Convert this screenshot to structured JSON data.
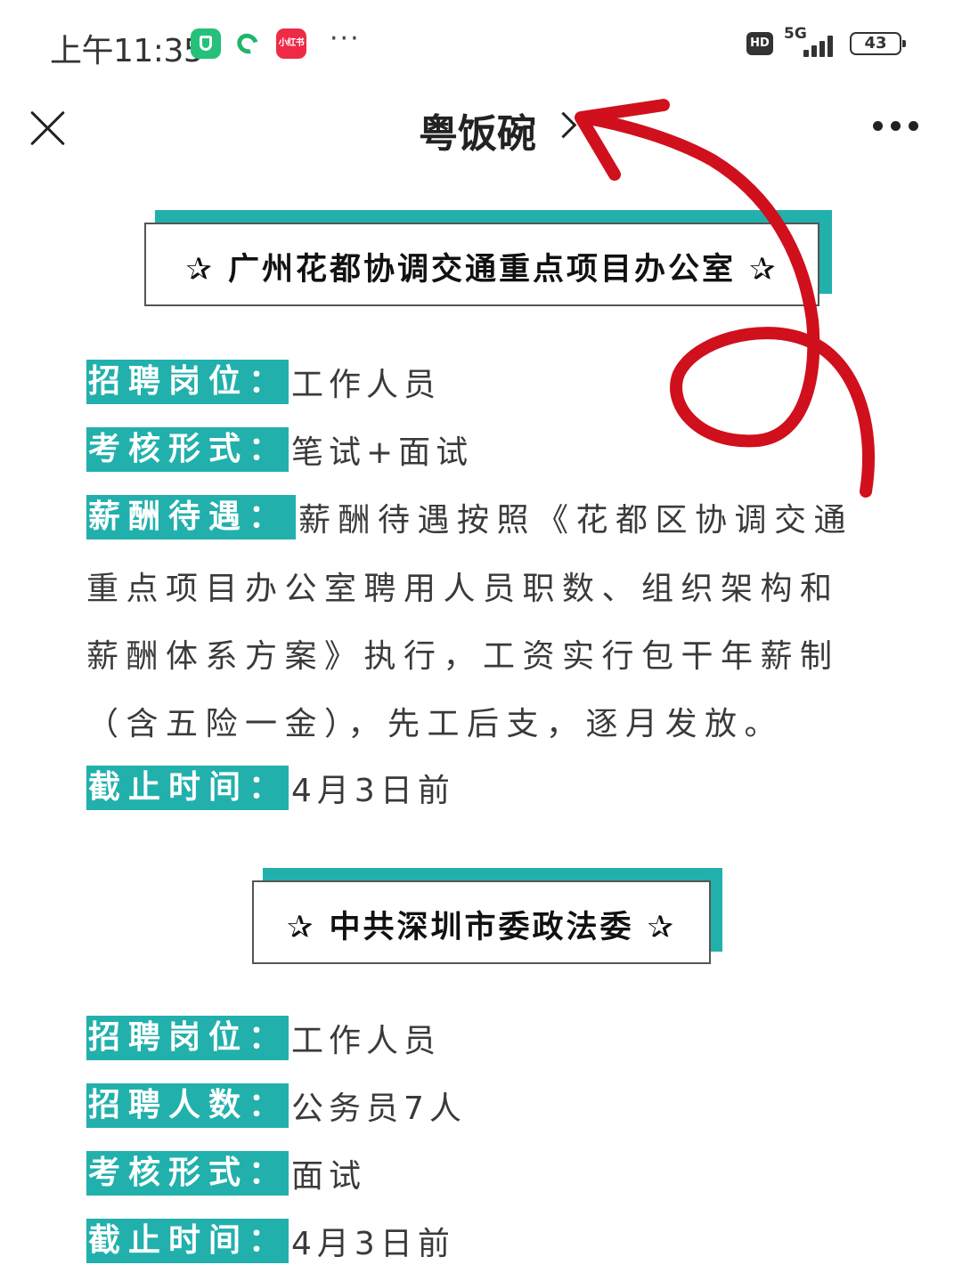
{
  "status_bar": {
    "time": "上午11:35",
    "app_badge": "小红书",
    "more": "···",
    "hd": "HD",
    "network": "5G",
    "battery": "43"
  },
  "nav": {
    "title": "粤饭碗"
  },
  "sections": [
    {
      "title": "✰ 广州花都协调交通重点项目办公室 ✰",
      "rows": [
        {
          "label": "招聘岗位：",
          "value": "工作人员"
        },
        {
          "label": "考核形式：",
          "value": "笔试+面试"
        },
        {
          "label": "薪酬待遇：",
          "value": "薪酬待遇按照《花都区协调交通"
        },
        {
          "label": "截止时间：",
          "value": "4月3日前"
        }
      ],
      "salary_lines": [
        "重点项目办公室聘用人员职数、组织架构和",
        "薪酬体系方案》执行，工资实行包干年薪制",
        "（含五险一金），先工后支，逐月发放。"
      ]
    },
    {
      "title": "✰ 中共深圳市委政法委 ✰",
      "rows": [
        {
          "label": "招聘岗位：",
          "value": "工作人员"
        },
        {
          "label": "招聘人数：",
          "value": "公务员7人"
        },
        {
          "label": "考核形式：",
          "value": "面试"
        },
        {
          "label": "截止时间：",
          "value": "4月3日前"
        }
      ]
    }
  ],
  "colors": {
    "accent": "#22b0ac",
    "annotation": "#d0101c",
    "text": "#3a3a3a"
  }
}
